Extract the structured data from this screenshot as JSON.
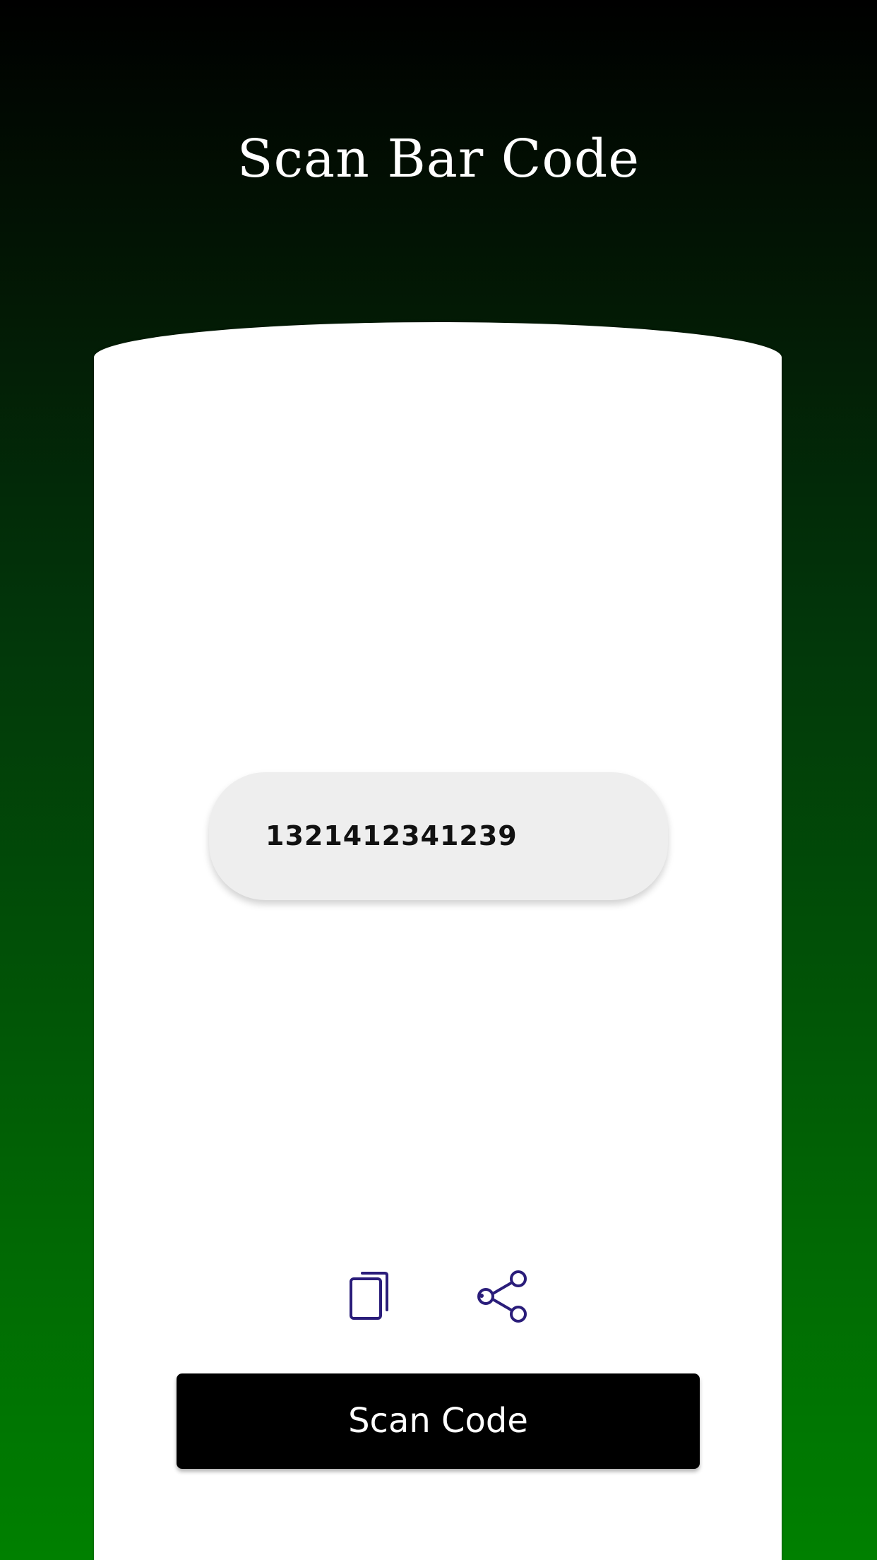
{
  "header": {
    "title": "Scan Bar Code"
  },
  "result": {
    "value": "1321412341239"
  },
  "actions": {
    "copy_icon": "copy-icon",
    "share_icon": "share-icon",
    "icon_color": "#2a1d7a"
  },
  "scan_button": {
    "label": "Scan Code"
  },
  "colors": {
    "gradient_top": "#000000",
    "gradient_bottom": "#008000",
    "card": "#ffffff",
    "field": "#eeeeee",
    "button": "#000000"
  }
}
